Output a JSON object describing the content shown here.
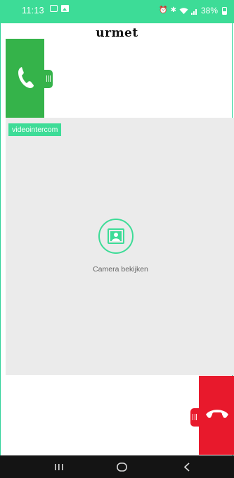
{
  "statusbar": {
    "time": "11:13",
    "battery": "38%",
    "icons": [
      "message-box-icon",
      "image-notification-icon",
      "alarm-icon",
      "vibrate-icon",
      "wifi-icon",
      "signal-icon",
      "battery-icon"
    ]
  },
  "header": {
    "logo": "urmet"
  },
  "video": {
    "source_label": "videointercom",
    "camera_button_label": "Camera bekijken"
  },
  "colors": {
    "accent": "#3ddc97",
    "answer": "#35b34a",
    "hangup": "#e8192c",
    "video_bg": "#ebebeb",
    "navbar": "#141414"
  },
  "navbar": {
    "buttons": [
      "recent-apps",
      "home",
      "back"
    ]
  }
}
